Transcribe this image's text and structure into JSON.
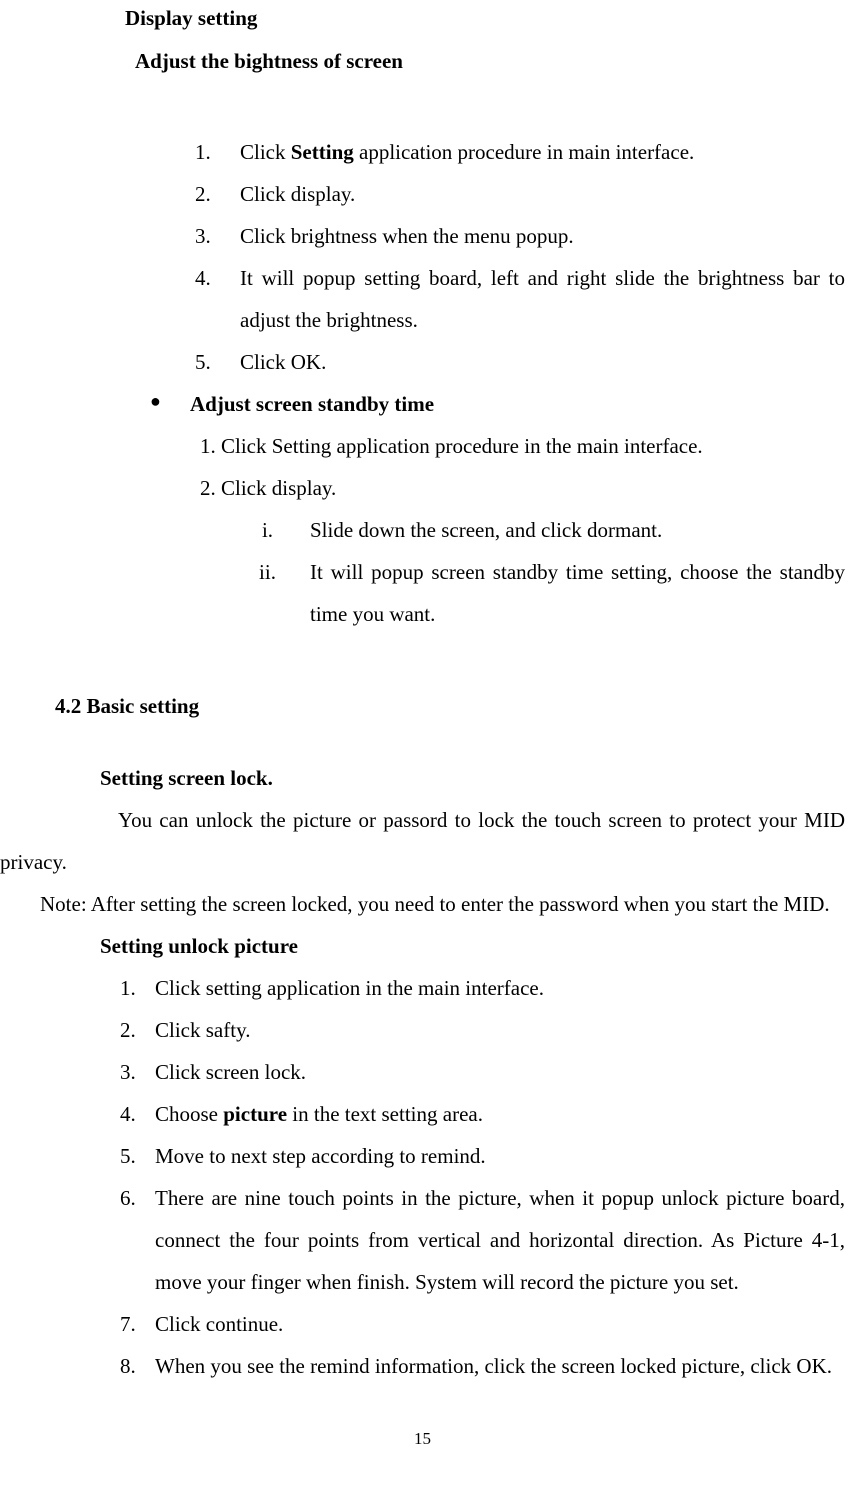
{
  "heading1": "Display setting",
  "heading2": "Adjust the bightness of screen",
  "list1": {
    "item1_num": "1.",
    "item1_pre": "Click ",
    "item1_bold": "Setting",
    "item1_post": " application procedure in main interface.",
    "item2_num": "2.",
    "item2_txt": "Click display.",
    "item3_num": "3.",
    "item3_txt": "Click brightness when the menu popup.",
    "item4_num": "4.",
    "item4_txt": "It will popup setting board, left and right slide the brightness bar to adjust the brightness.",
    "item5_num": "5.",
    "item5_txt": "Click OK."
  },
  "bullet": "●",
  "heading_bullet": "Adjust screen standby time",
  "sub1": "1. Click Setting application procedure in the main interface.",
  "sub2": "2. Click display.",
  "roman": {
    "i_num": "i.",
    "i_txt": "Slide down the screen, and click dormant.",
    "ii_num": "ii.",
    "ii_txt": "It will popup screen standby time setting, choose the standby time you want."
  },
  "heading4": "4.2 Basic setting",
  "heading5": "Setting screen lock.",
  "para1": "You can unlock the picture or passord to lock the touch screen to protect your MID privacy.",
  "para2": "Note: After setting the screen locked, you need to enter the password when you start the MID.",
  "heading6": "Setting unlock picture",
  "list2": {
    "item1_num": "1.",
    "item1_txt": "Click setting application in the main interface.",
    "item2_num": "2.",
    "item2_txt": "Click safty.",
    "item3_num": "3.",
    "item3_txt": "Click screen lock.",
    "item4_num": "4.",
    "item4_pre": "Choose ",
    "item4_bold": "picture",
    "item4_post": " in the text setting area.",
    "item5_num": "5.",
    "item5_txt": "Move to next step according to remind.",
    "item6_num": "6.",
    "item6_txt": "There are nine touch points in the picture, when it popup unlock picture board, connect the four points from vertical and horizontal direction. As Picture 4-1, move your finger when finish. System will record the picture you set.",
    "item7_num": "7.",
    "item7_txt": "Click continue.",
    "item8_num": "8.",
    "item8_txt": "When you see the remind information, click the screen locked picture, click OK."
  },
  "page_number": "15"
}
